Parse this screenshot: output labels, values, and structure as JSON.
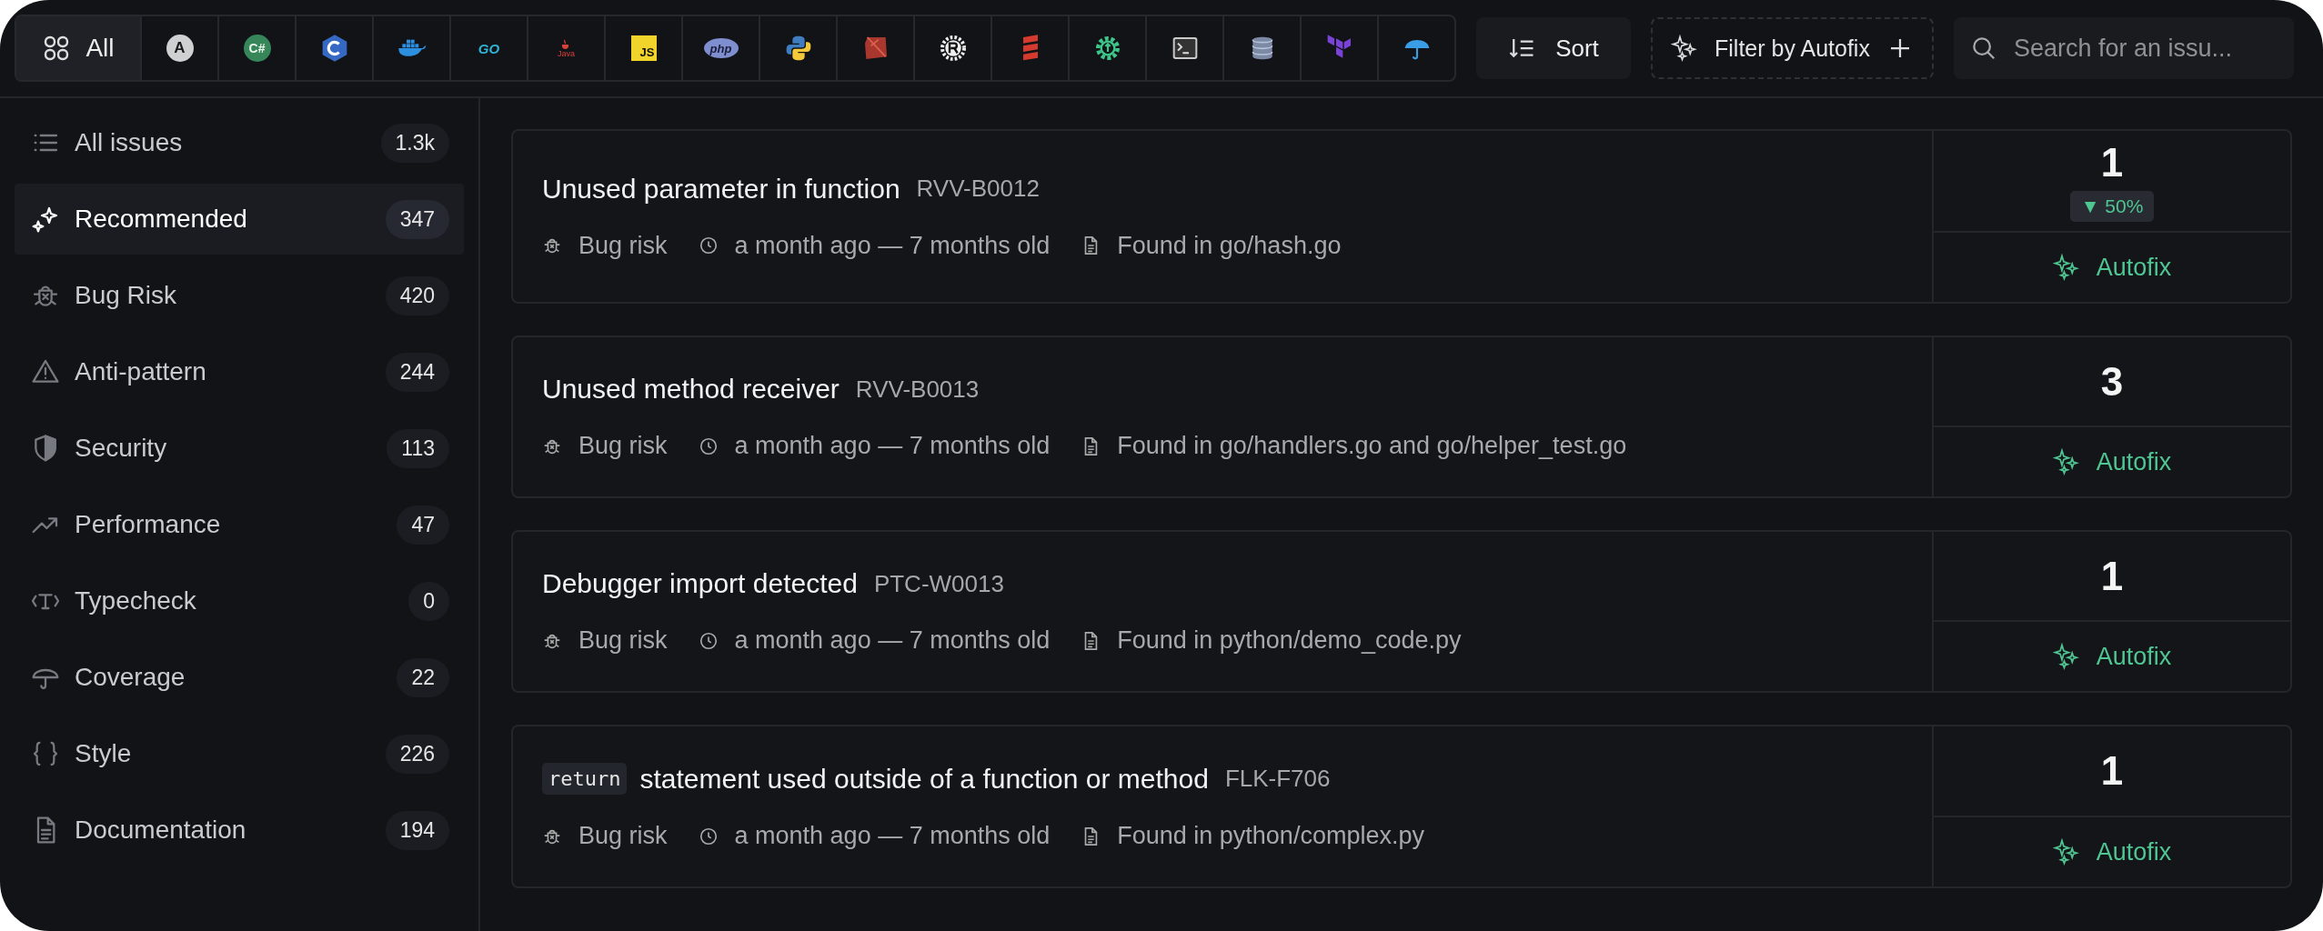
{
  "language_tabs": [
    {
      "label": "All",
      "selected": true
    },
    {
      "logo_text": "A",
      "selected": false
    },
    {
      "logo_text": "C#",
      "selected": false
    },
    {
      "selected": false
    },
    {
      "selected": false
    },
    {
      "logo_text": "GO",
      "selected": false
    },
    {
      "logo_text": "Java",
      "selected": false
    },
    {
      "logo_text": "JS",
      "selected": false
    },
    {
      "logo_text": "php",
      "selected": false
    },
    {
      "selected": false
    },
    {
      "selected": false
    },
    {
      "selected": false
    },
    {
      "selected": false
    },
    {
      "selected": false
    },
    {
      "selected": false
    },
    {
      "selected": false
    },
    {
      "selected": false
    },
    {
      "selected": false
    }
  ],
  "sort_button": {
    "label": "Sort"
  },
  "autofix_filter": {
    "label": "Filter by Autofix"
  },
  "search": {
    "placeholder": "Search for an issu..."
  },
  "sidebar": {
    "items": [
      {
        "label": "All issues",
        "count": "1.3k",
        "selected": false
      },
      {
        "label": "Recommended",
        "count": "347",
        "selected": true
      },
      {
        "label": "Bug Risk",
        "count": "420",
        "selected": false
      },
      {
        "label": "Anti-pattern",
        "count": "244",
        "selected": false
      },
      {
        "label": "Security",
        "count": "113",
        "selected": false
      },
      {
        "label": "Performance",
        "count": "47",
        "selected": false
      },
      {
        "label": "Typecheck",
        "count": "0",
        "selected": false
      },
      {
        "label": "Coverage",
        "count": "22",
        "selected": false
      },
      {
        "label": "Style",
        "count": "226",
        "selected": false
      },
      {
        "label": "Documentation",
        "count": "194",
        "selected": false
      }
    ]
  },
  "issues": [
    {
      "title": "Unused parameter in function",
      "code": "RVV-B0012",
      "category": "Bug risk",
      "age": "a month ago — 7 months old",
      "location": "Found in go/hash.go",
      "occurrences": "1",
      "trend": "▼ 50%",
      "autofix": "Autofix"
    },
    {
      "title": "Unused method receiver",
      "code": "RVV-B0013",
      "category": "Bug risk",
      "age": "a month ago — 7 months old",
      "location": "Found in go/handlers.go and go/helper_test.go",
      "occurrences": "3",
      "autofix": "Autofix"
    },
    {
      "title": "Debugger import detected",
      "code": "PTC-W0013",
      "category": "Bug risk",
      "age": "a month ago — 7 months old",
      "location": "Found in python/demo_code.py",
      "occurrences": "1",
      "autofix": "Autofix"
    },
    {
      "title_code": "return",
      "title": "statement used outside of a function or method",
      "code": "FLK-F706",
      "category": "Bug risk",
      "age": "a month ago — 7 months old",
      "location": "Found in python/complex.py",
      "occurrences": "1",
      "autofix": "Autofix"
    }
  ]
}
